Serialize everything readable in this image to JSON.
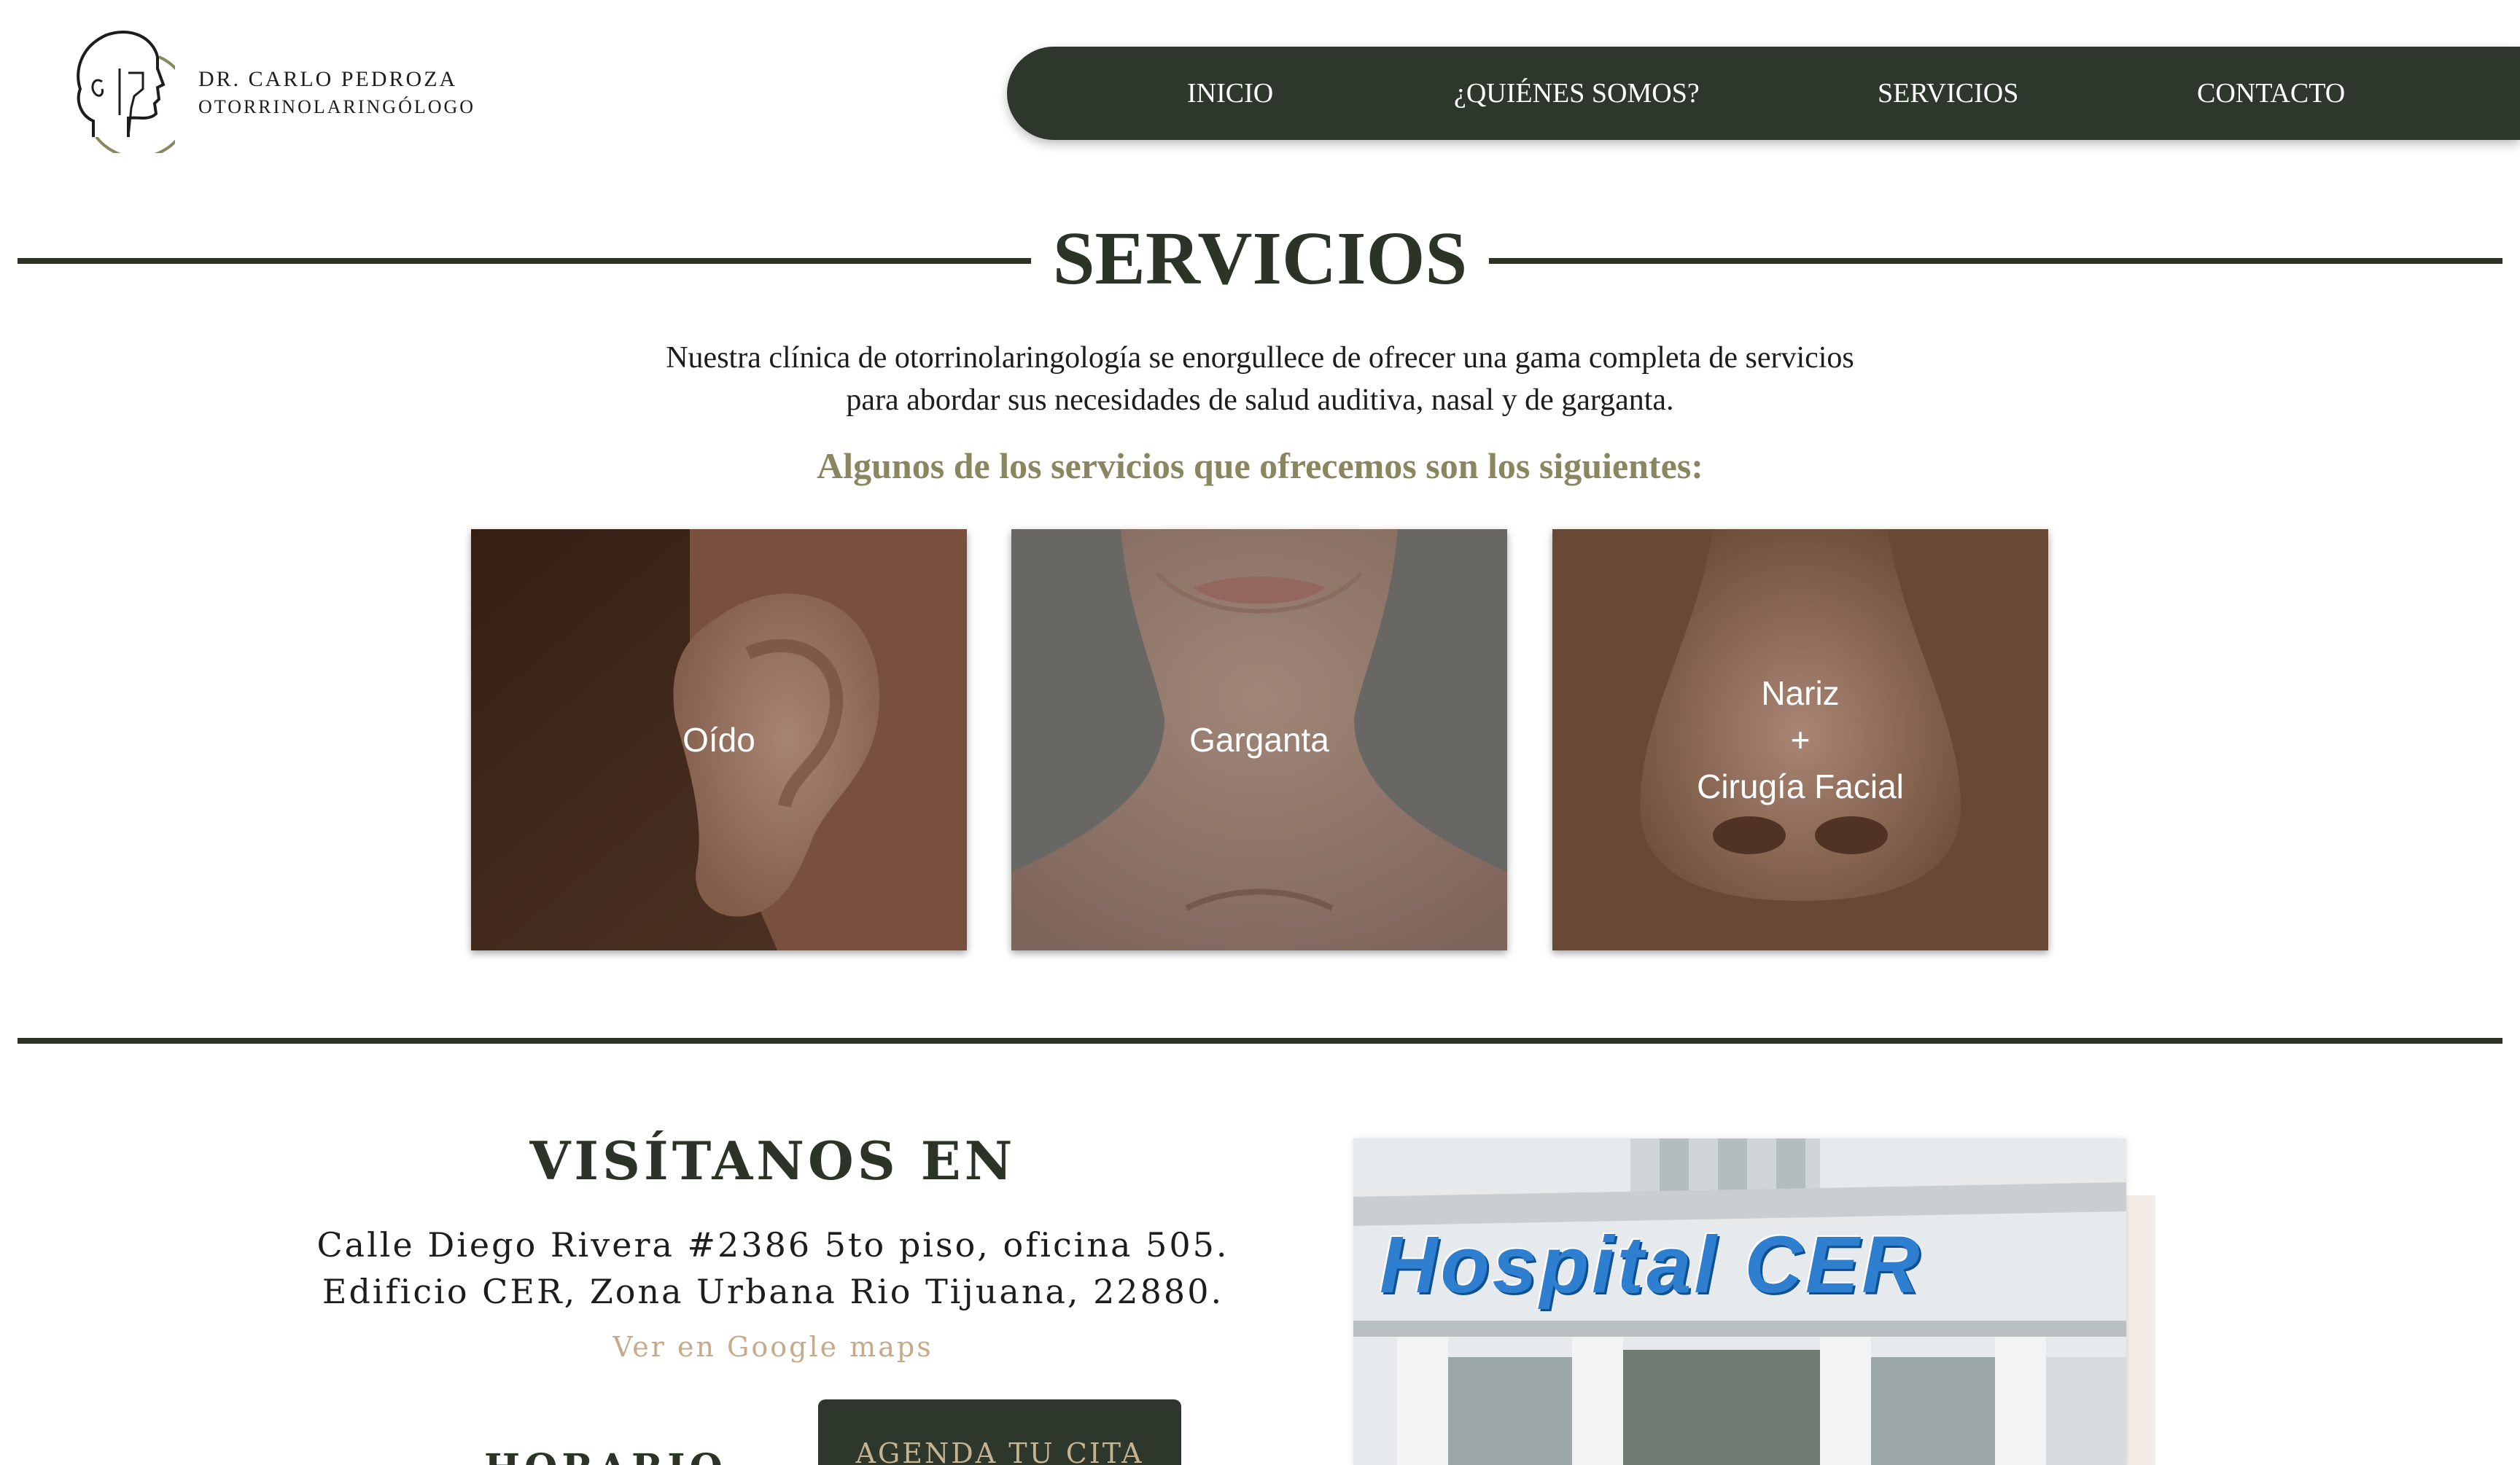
{
  "header": {
    "brand_name": "DR. CARLO PEDROZA",
    "brand_subtitle": "OTORRINOLARINGÓLOGO",
    "logo_icon": "head-profile-icon"
  },
  "nav": {
    "items": [
      {
        "label": "INICIO"
      },
      {
        "label": "¿QUIÉNES SOMOS?"
      },
      {
        "label": "SERVICIOS"
      },
      {
        "label": "CONTACTO"
      }
    ]
  },
  "servicios": {
    "title": "SERVICIOS",
    "intro": "Nuestra clínica de otorrinolaringología se enorgullece de ofrecer una gama completa de servicios para abordar sus necesidades de salud auditiva, nasal y de garganta.",
    "subheading": "Algunos de los servicios que ofrecemos son los siguientes:",
    "cards": [
      {
        "label": "Oído"
      },
      {
        "label": "Garganta"
      },
      {
        "label_line1": "Nariz",
        "label_line2": "+",
        "label_line3": "Cirugía Facial"
      }
    ]
  },
  "visit": {
    "title": "VISÍTANOS EN",
    "address_line1": "Calle Diego Rivera #2386 5to piso, oficina 505.",
    "address_line2": "Edificio CER, Zona Urbana Rio Tijuana, 22880.",
    "maps_link": "Ver en Google maps",
    "horario": "HORARIO",
    "cta": "AGENDA TU CITA",
    "hospital_sign": "Hospital CER"
  },
  "colors": {
    "primary_dark": "#2d372b",
    "accent_olive": "#8a8660",
    "accent_tan": "#c7a98b",
    "white": "#ffffff"
  }
}
